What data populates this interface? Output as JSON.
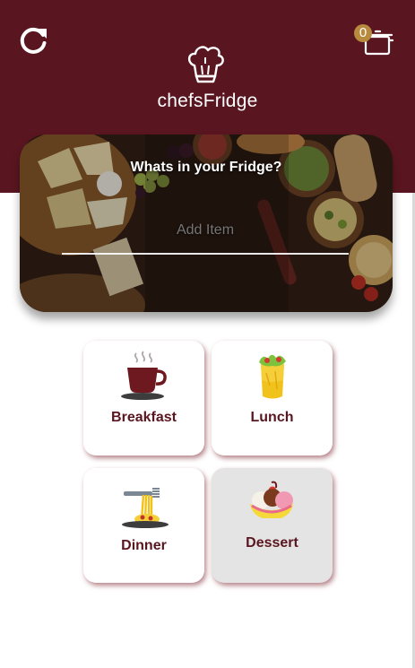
{
  "header": {
    "app_title": "chefsFridge",
    "cart_count": "0",
    "refresh_icon": "refresh-icon",
    "cart_icon": "cooking-pot-icon",
    "logo_icon": "chef-hat-icon"
  },
  "hero": {
    "question": "Whats in your Fridge?",
    "add_item_placeholder": "Add Item"
  },
  "meals": [
    {
      "label": "Breakfast",
      "icon": "coffee-cup-icon"
    },
    {
      "label": "Lunch",
      "icon": "wrap-icon"
    },
    {
      "label": "Dinner",
      "icon": "spaghetti-fork-icon"
    },
    {
      "label": "Dessert",
      "icon": "banana-split-icon"
    }
  ],
  "colors": {
    "brand": "#5a1620",
    "badge": "#b88a3e",
    "selected_card": "#e5e4e4"
  }
}
